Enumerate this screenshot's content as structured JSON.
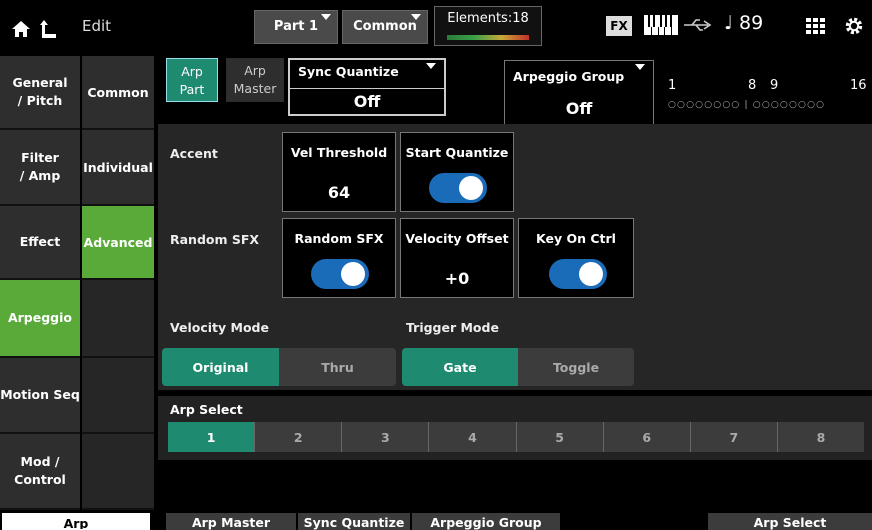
{
  "header": {
    "edit_label": "Edit",
    "part": "Part 1",
    "common": "Common",
    "elements": "Elements:18",
    "fx": "FX",
    "tempo": "♩ 89"
  },
  "left_tabs": [
    "General\n/ Pitch",
    "Filter\n/ Amp",
    "Effect",
    "Arpeggio",
    "Motion Seq",
    "Mod /\nControl"
  ],
  "mid_tabs": [
    "Common",
    "Individual",
    "Advanced"
  ],
  "top_controls": {
    "arp_part": "Arp\nPart",
    "arp_master": "Arp\nMaster",
    "sync_quantize_label": "Sync Quantize",
    "sync_quantize_value": "Off",
    "arp_group_label": "Arpeggio Group",
    "arp_group_value": "Off",
    "seg_n1": "1",
    "seg_n8": "8",
    "seg_n9": "9",
    "seg_n16": "16",
    "seg_dots": "○○○○○○○○ | ○○○○○○○○"
  },
  "panel": {
    "accent": "Accent",
    "vel_threshold_label": "Vel Threshold",
    "vel_threshold_value": "64",
    "start_quantize_label": "Start Quantize",
    "random_sfx_row": "Random SFX",
    "random_sfx_label": "Random SFX",
    "velocity_offset_label": "Velocity Offset",
    "velocity_offset_value": "+0",
    "key_on_ctrl_label": "Key On Ctrl",
    "velocity_mode_label": "Velocity Mode",
    "velocity_mode_options": [
      "Original",
      "Thru"
    ],
    "trigger_mode_label": "Trigger Mode",
    "trigger_mode_options": [
      "Gate",
      "Toggle"
    ]
  },
  "arp_select": {
    "label": "Arp Select",
    "options": [
      "1",
      "2",
      "3",
      "4",
      "5",
      "6",
      "7",
      "8"
    ]
  },
  "bottom_tabs": [
    "Arp",
    "Arp Master",
    "Sync Quantize",
    "Arpeggio Group",
    "Arp Select"
  ],
  "colors": {
    "accent_green": "#5aaa3a",
    "teal": "#1e8a70",
    "toggle_blue": "#1a6bb8"
  }
}
